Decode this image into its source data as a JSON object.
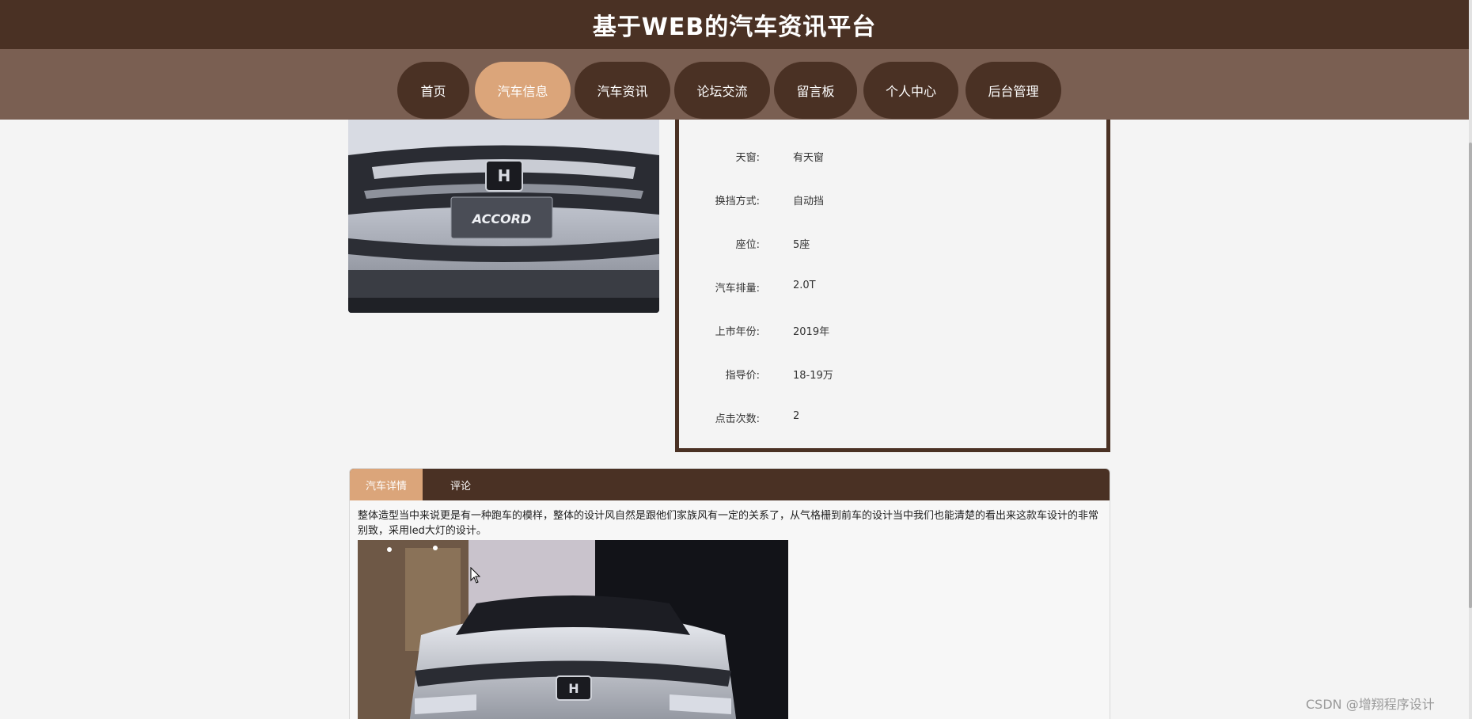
{
  "header": {
    "title": "基于WEB的汽车资讯平台"
  },
  "nav": {
    "items": [
      {
        "label": "首页"
      },
      {
        "label": "汽车信息"
      },
      {
        "label": "汽车资讯"
      },
      {
        "label": "论坛交流"
      },
      {
        "label": "留言板"
      },
      {
        "label": "个人中心"
      },
      {
        "label": "后台管理"
      }
    ],
    "active": "汽车信息"
  },
  "specs": [
    {
      "label": "天窗:",
      "value": "有天窗"
    },
    {
      "label": "换挡方式:",
      "value": "自动挡"
    },
    {
      "label": "座位:",
      "value": "5座"
    },
    {
      "label": "汽车排量:",
      "value": "2.0T"
    },
    {
      "label": "上市年份:",
      "value": "2019年"
    },
    {
      "label": "指导价:",
      "value": "18-19万"
    },
    {
      "label": "点击次数:",
      "value": "2"
    }
  ],
  "tabs": [
    {
      "label": "汽车详情"
    },
    {
      "label": "评论"
    }
  ],
  "detail": {
    "text": "整体造型当中来说更是有一种跑车的模样，整体的设计风自然是跟他们家族风有一定的关系了，从气格栅到前车的设计当中我们也能清楚的看出来这款车设计的非常别致，采用led大灯的设计。"
  },
  "photo": {
    "badge": "ACCORD"
  },
  "watermark": "CSDN @增翔程序设计",
  "colors": {
    "brown": "#4a3124",
    "nav_bg": "#7a5f52",
    "accent": "#dba57a",
    "page_bg": "#f4f4f4"
  }
}
